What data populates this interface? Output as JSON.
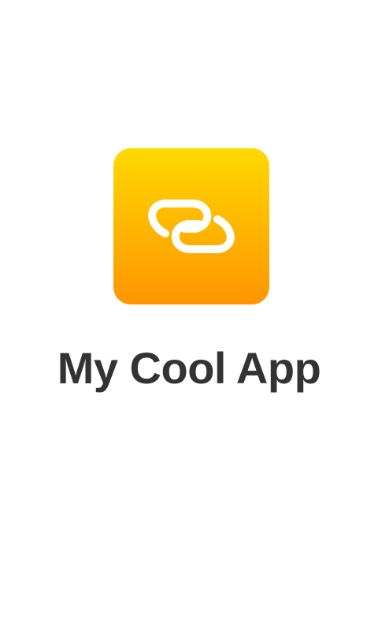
{
  "splash": {
    "app_name": "My Cool App",
    "icon": {
      "name": "linked-rings-icon",
      "gradient_top": "#ffd900",
      "gradient_bottom": "#ff9500",
      "glyph_color": "#ffffff"
    },
    "text_color": "#333333",
    "background": "#ffffff"
  }
}
